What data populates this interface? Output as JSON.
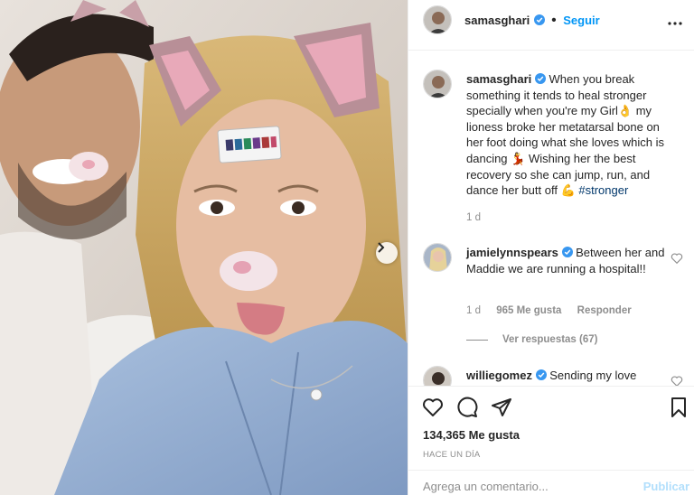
{
  "photo": {
    "next_icon": "chevron-right-icon",
    "thermometer_labels": [
      "2 8",
      "2 9",
      "3 0",
      "3 1",
      "3 2"
    ]
  },
  "header": {
    "username": "samasghari",
    "separator": "•",
    "follow_label": "Seguir",
    "more_icon": "more-horizontal-icon"
  },
  "caption": {
    "username": "samasghari",
    "text_part1": "When you break something it tends to heal stronger specially when you're my Girl👌 my lioness broke her metatarsal bone on her foot doing what she loves which is dancing 💃 Wishing her the best recovery so she can jump, run, and dance her butt off 💪",
    "hashtag": "#stronger",
    "time": "1 d"
  },
  "comments": [
    {
      "username": "jamielynnspears",
      "text": "Between her and Maddie we are running a hospital!!",
      "time": "1 d",
      "likes": "965 Me gusta",
      "reply_label": "Responder",
      "view_replies": "Ver respuestas (67)"
    },
    {
      "username": "williegomez",
      "text": "Sending my love"
    }
  ],
  "actions": {
    "like_icon": "heart-icon",
    "comment_icon": "comment-icon",
    "share_icon": "send-icon",
    "save_icon": "bookmark-icon",
    "likes_count": "134,365 Me gusta",
    "date": "HACE UN DÍA"
  },
  "comment_box": {
    "placeholder": "Agrega un comentario...",
    "post_label": "Publicar"
  },
  "colors": {
    "accent": "#0095f6",
    "verified": "#3897f0",
    "hashtag": "#00376b",
    "muted": "#8e8e8e",
    "post_disabled": "#b2dffc"
  }
}
